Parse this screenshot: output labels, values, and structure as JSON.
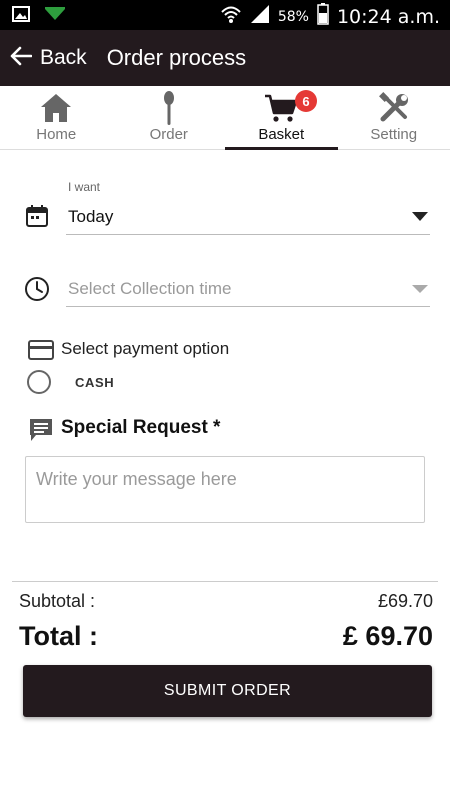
{
  "status_bar": {
    "battery_percent": "58%",
    "time": "10:24 a.m.",
    "icons": [
      "image-icon",
      "download-icon",
      "wifi-icon",
      "signal-icon",
      "battery-icon"
    ]
  },
  "app_bar": {
    "back_label": "Back",
    "title": "Order process",
    "background_color": "#231a1e"
  },
  "tabs": [
    {
      "label": "Home",
      "icon": "home-icon",
      "active": false
    },
    {
      "label": "Order",
      "icon": "spoon-icon",
      "active": false
    },
    {
      "label": "Basket",
      "icon": "cart-icon",
      "active": true,
      "badge": "6"
    },
    {
      "label": "Setting",
      "icon": "tools-icon",
      "active": false
    }
  ],
  "form": {
    "day_label": "I want",
    "day_value": "Today",
    "time_placeholder": "Select Collection time",
    "payment_label": "Select payment option",
    "payment_options": [
      {
        "label": "CASH",
        "selected": false
      }
    ],
    "special_request_label": "Special Request *",
    "message_placeholder": "Write your message here"
  },
  "totals": {
    "subtotal_label": "Subtotal :",
    "subtotal_value": "£69.70",
    "total_label": "Total :",
    "total_value": "£ 69.70"
  },
  "submit_label": "SUBMIT ORDER",
  "colors": {
    "accent": "#231a1e",
    "badge": "#e53935"
  }
}
